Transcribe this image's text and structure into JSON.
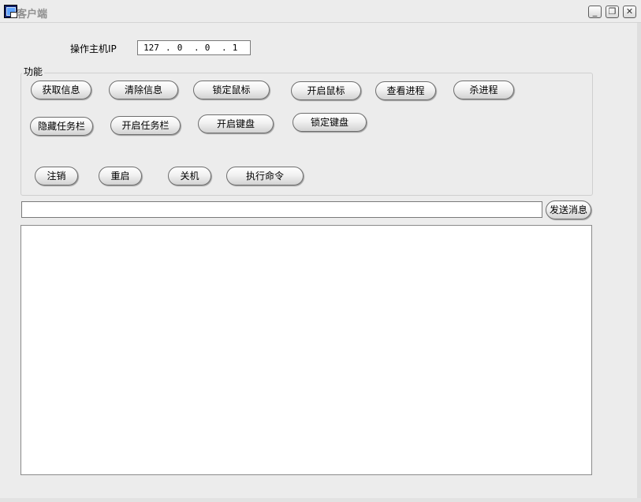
{
  "window": {
    "title": "客户端",
    "minimize_symbol": "_",
    "restore_symbol": "❐",
    "close_symbol": "✕"
  },
  "host": {
    "label": "操作主机IP",
    "ip": [
      "127",
      "0",
      "0",
      "1"
    ],
    "ip_separator": "."
  },
  "functions": {
    "group_label": "功能",
    "buttons": [
      "获取信息",
      "清除信息",
      "锁定鼠标",
      "开启鼠标",
      "查看进程",
      "杀进程",
      "隐藏任务栏",
      "开启任务栏",
      "开启键盘",
      "锁定键盘",
      "注销",
      "重启",
      "关机",
      "执行命令"
    ]
  },
  "message": {
    "input_value": "",
    "send_label": "发送消息"
  },
  "output": {
    "text": ""
  }
}
